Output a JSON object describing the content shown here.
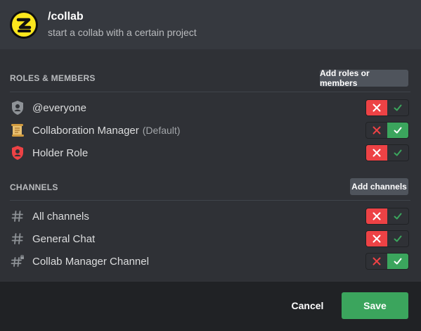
{
  "colors": {
    "accent_yellow": "#fce71d",
    "deny": "#ed4245",
    "allow": "#3ba55d",
    "background": "#36393f",
    "panel": "#2f3136",
    "footer": "#202225"
  },
  "header": {
    "title": "/collab",
    "description": "start a collab with a certain project",
    "icon": "bot-logo-icon"
  },
  "roles_section": {
    "title": "ROLES & MEMBERS",
    "add_button": "Add roles or members",
    "items": [
      {
        "label": "@everyone",
        "default_tag": "",
        "icon": "role-shield-icon",
        "state": "deny"
      },
      {
        "label": "Collaboration Manager",
        "default_tag": "(Default)",
        "icon": "scroll-icon",
        "state": "allow"
      },
      {
        "label": "Holder Role",
        "default_tag": "",
        "icon": "red-role-shield-icon",
        "state": "deny"
      }
    ]
  },
  "channels_section": {
    "title": "CHANNELS",
    "add_button": "Add channels",
    "items": [
      {
        "label": "All channels",
        "icon": "hashtag-icon",
        "state": "deny"
      },
      {
        "label": "General Chat",
        "icon": "hashtag-icon",
        "state": "deny"
      },
      {
        "label": "Collab Manager Channel",
        "icon": "locked-hashtag-icon",
        "state": "allow"
      }
    ]
  },
  "footer": {
    "cancel": "Cancel",
    "save": "Save"
  }
}
